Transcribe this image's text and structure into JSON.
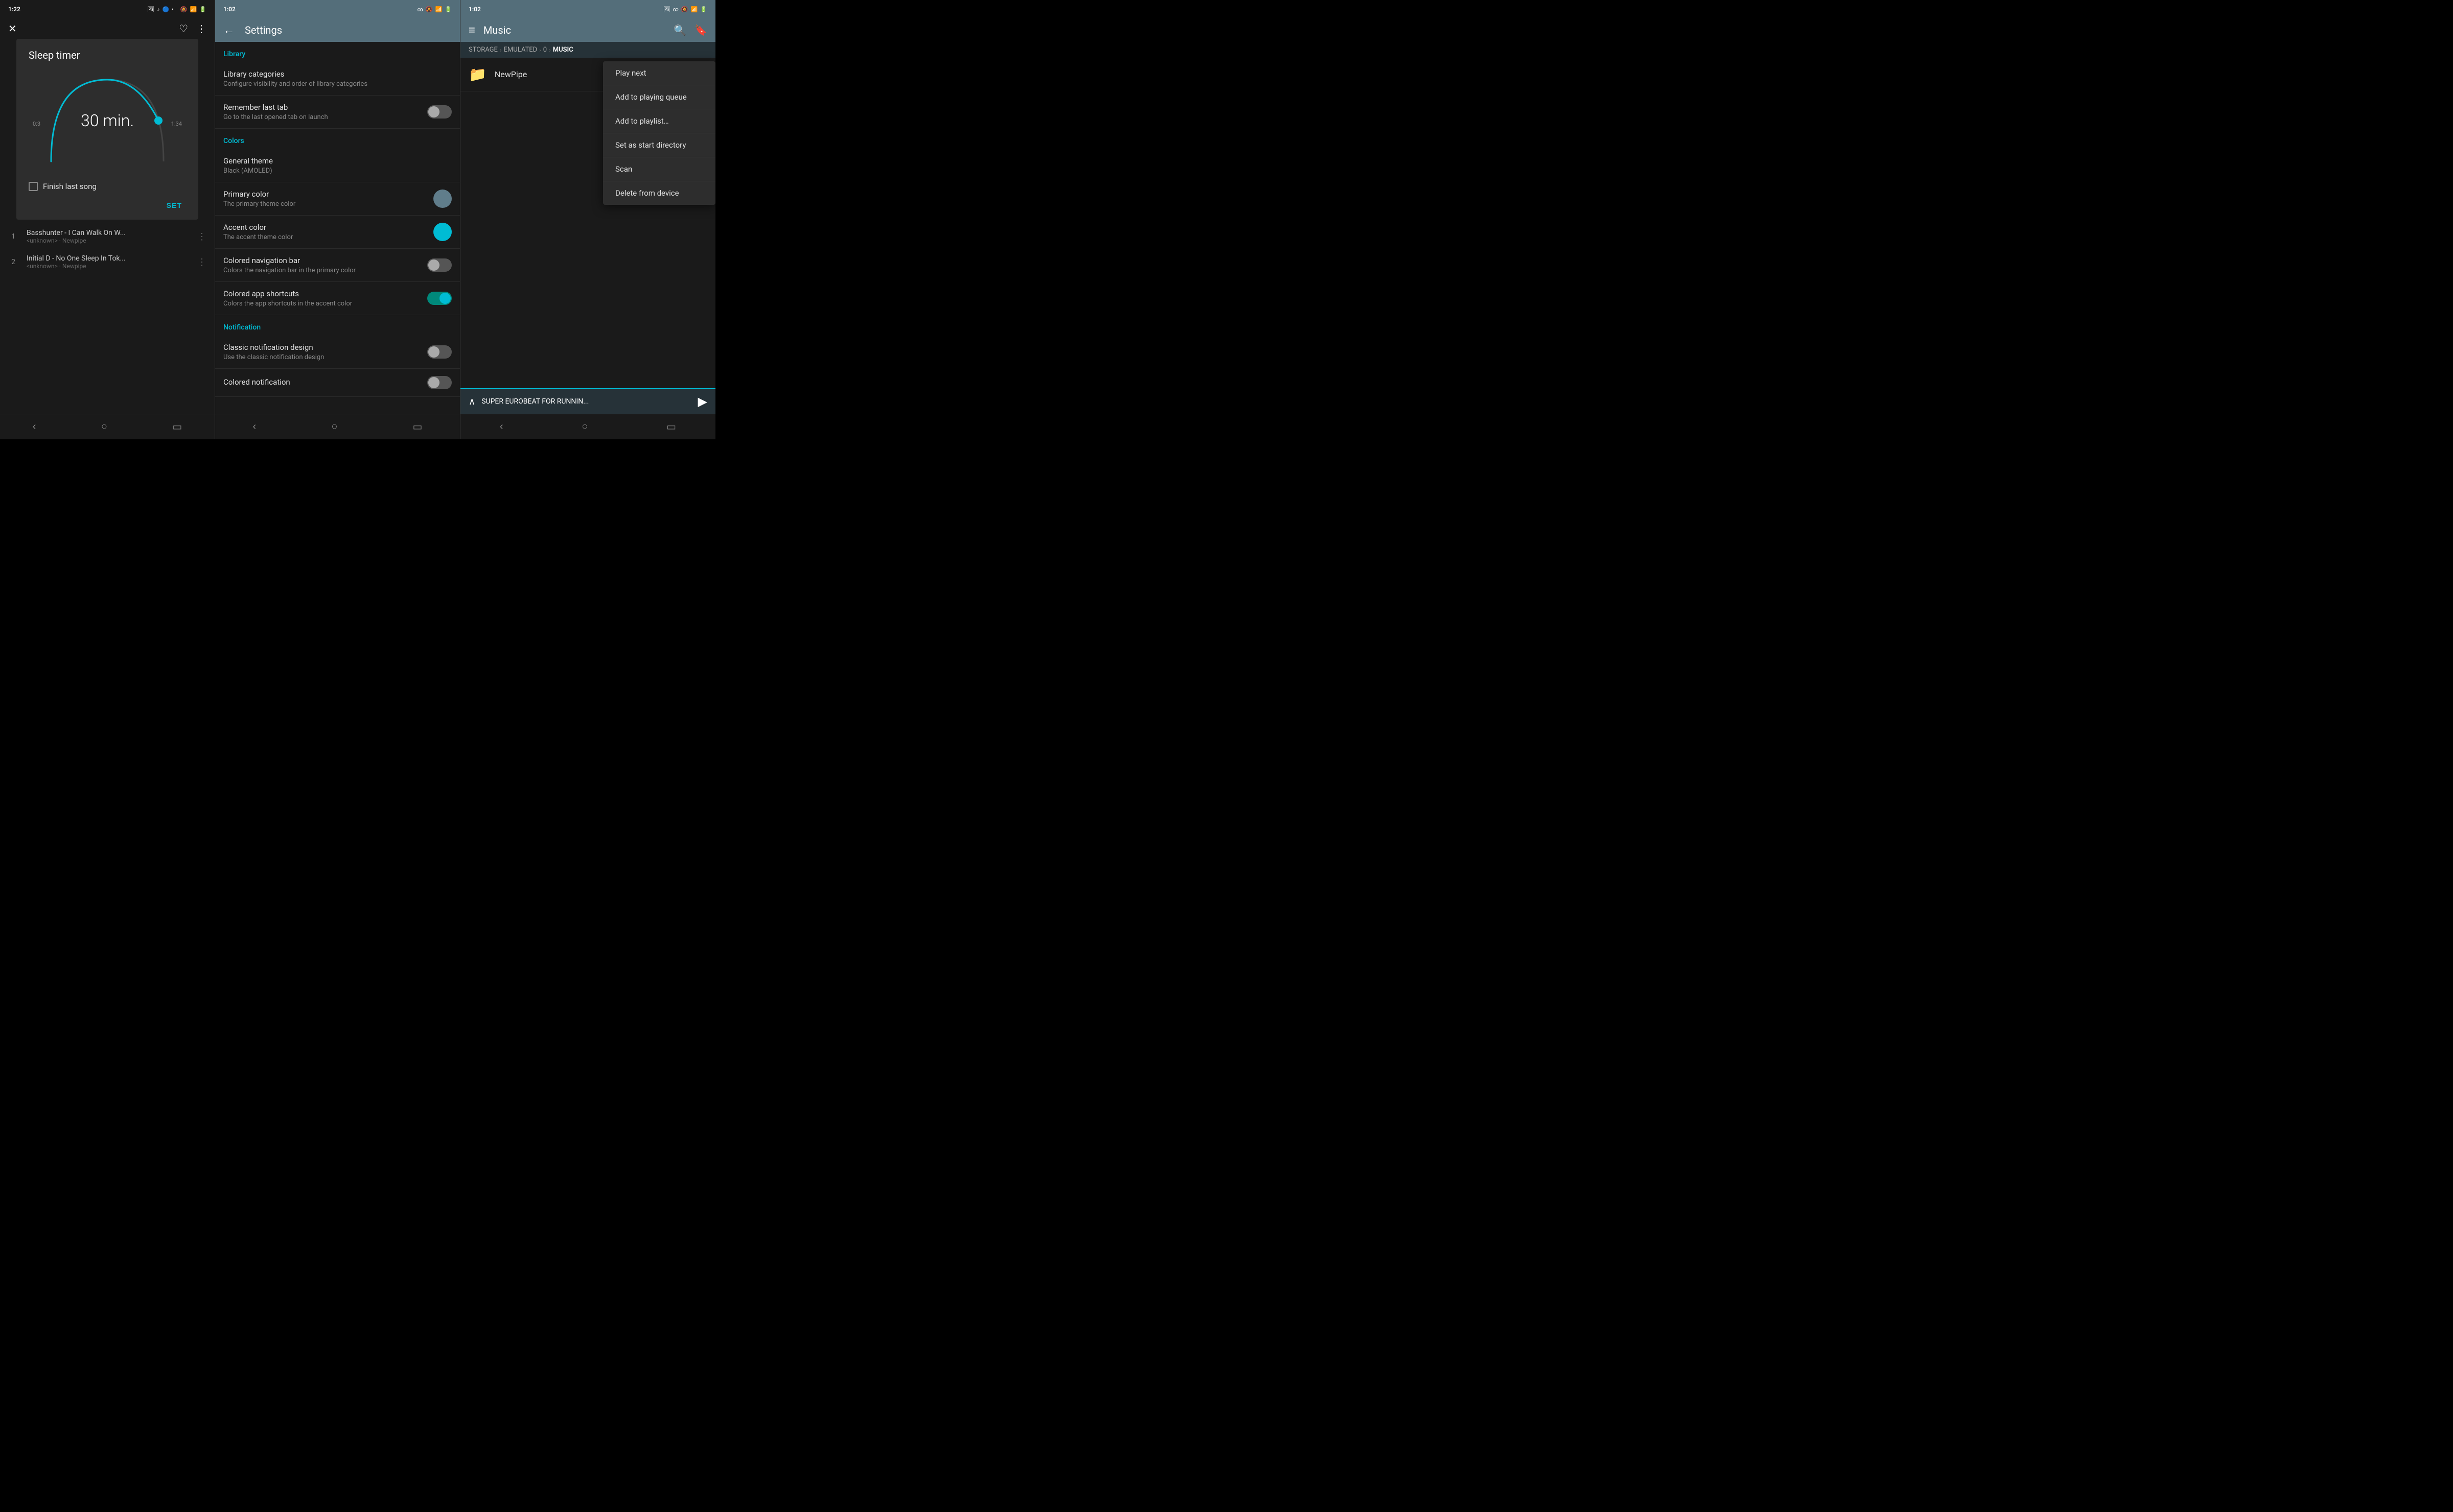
{
  "panel1": {
    "statusbar": {
      "time": "1:22",
      "icons": "🔕 🎵 🔵 •"
    },
    "topbar": {
      "close_label": "✕",
      "heart_label": "♡",
      "more_label": "⋮"
    },
    "sleep_timer": {
      "title": "Sleep timer",
      "minutes": "30 min.",
      "left_time": "0:3",
      "right_time": "1:34",
      "finish_last_song_label": "Finish last song",
      "set_label": "SET"
    },
    "songs": [
      {
        "num": "1",
        "title": "Basshunter - I Can Walk On W...",
        "meta": "<unknown> · Newpipe"
      },
      {
        "num": "2",
        "title": "Initial D - No One Sleep In Tok...",
        "meta": "<unknown> · Newpipe"
      }
    ],
    "navbar": {
      "back": "‹",
      "home": "○",
      "recents": "▭"
    }
  },
  "panel2": {
    "statusbar": {
      "time": "1:02",
      "icons": "∞ 🔕 📶 🔋"
    },
    "topbar": {
      "back_label": "←",
      "title": "Settings"
    },
    "sections": [
      {
        "header": "Library",
        "items": [
          {
            "title": "Library categories",
            "desc": "Configure visibility and order of library categories",
            "type": "text"
          },
          {
            "title": "Remember last tab",
            "desc": "Go to the last opened tab on launch",
            "type": "toggle",
            "state": "off"
          }
        ]
      },
      {
        "header": "Colors",
        "items": [
          {
            "title": "General theme",
            "desc": "Black (AMOLED)",
            "type": "text"
          },
          {
            "title": "Primary color",
            "desc": "The primary theme color",
            "type": "color",
            "color": "#607d8b"
          },
          {
            "title": "Accent color",
            "desc": "The accent theme color",
            "type": "color",
            "color": "#00bcd4"
          },
          {
            "title": "Colored navigation bar",
            "desc": "Colors the navigation bar in the primary color",
            "type": "toggle",
            "state": "off"
          },
          {
            "title": "Colored app shortcuts",
            "desc": "Colors the app shortcuts in the accent color",
            "type": "toggle",
            "state": "on"
          }
        ]
      },
      {
        "header": "Notification",
        "items": [
          {
            "title": "Classic notification design",
            "desc": "Use the classic notification design",
            "type": "toggle",
            "state": "off"
          },
          {
            "title": "Colored notification",
            "desc": "",
            "type": "toggle",
            "state": "off"
          }
        ]
      }
    ],
    "navbar": {
      "back": "‹",
      "home": "○",
      "recents": "▭"
    }
  },
  "panel3": {
    "statusbar": {
      "time": "1:02",
      "icons": "∞ 🔕 📶 🔋"
    },
    "topbar": {
      "menu_label": "≡",
      "title": "Music",
      "search_label": "🔍",
      "bookmark_label": "🔖"
    },
    "breadcrumbs": [
      {
        "label": "STORAGE",
        "active": false
      },
      {
        "label": "EMULATED",
        "active": false
      },
      {
        "label": "0",
        "active": false
      },
      {
        "label": "MUSIC",
        "active": true
      }
    ],
    "files": [
      {
        "name": "NewPipe",
        "type": "folder"
      }
    ],
    "context_menu": {
      "items": [
        "Play next",
        "Add to playing queue",
        "Add to playlist…",
        "Set as start directory",
        "Scan",
        "Delete from device"
      ]
    },
    "mini_player": {
      "title": "SUPER EUROBEAT FOR RUNNIN...",
      "chevron": "∧"
    },
    "navbar": {
      "back": "‹",
      "home": "○",
      "recents": "▭"
    }
  }
}
